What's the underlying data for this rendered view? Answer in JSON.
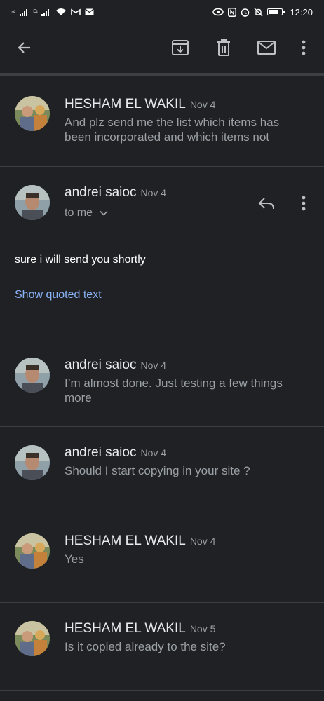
{
  "status_bar": {
    "signal1": "⁴⁶",
    "signal2": "ᴱ⁴",
    "time": "12:20"
  },
  "toolbar": {
    "back_icon": "arrow-left-icon",
    "archive_icon": "archive-icon",
    "delete_icon": "trash-icon",
    "mark_unread_icon": "mail-icon",
    "more_icon": "more-vert-icon"
  },
  "messages": [
    {
      "sender": "HESHAM EL WAKIL",
      "date": "Nov 4",
      "snippet": "And plz send me the list which items has been incorporated and which items not"
    },
    {
      "sender": "andrei saioc",
      "date": "Nov 4",
      "to": "to me",
      "body": "sure i will send you shortly",
      "quoted_link": "Show quoted text"
    },
    {
      "sender": "andrei saioc",
      "date": "Nov 4",
      "snippet": "I’m almost done. Just testing a few things more"
    },
    {
      "sender": "andrei saioc",
      "date": "Nov 4",
      "snippet": "Should I start copying in your site ?"
    },
    {
      "sender": "HESHAM EL WAKIL",
      "date": "Nov 4",
      "snippet": "Yes"
    },
    {
      "sender": "HESHAM EL WAKIL",
      "date": "Nov 5",
      "snippet": "Is it copied already to the site?"
    }
  ],
  "colors": {
    "background": "#202124",
    "text": "#e8eaed",
    "secondary": "#9aa0a6",
    "link": "#8ab4f8"
  }
}
